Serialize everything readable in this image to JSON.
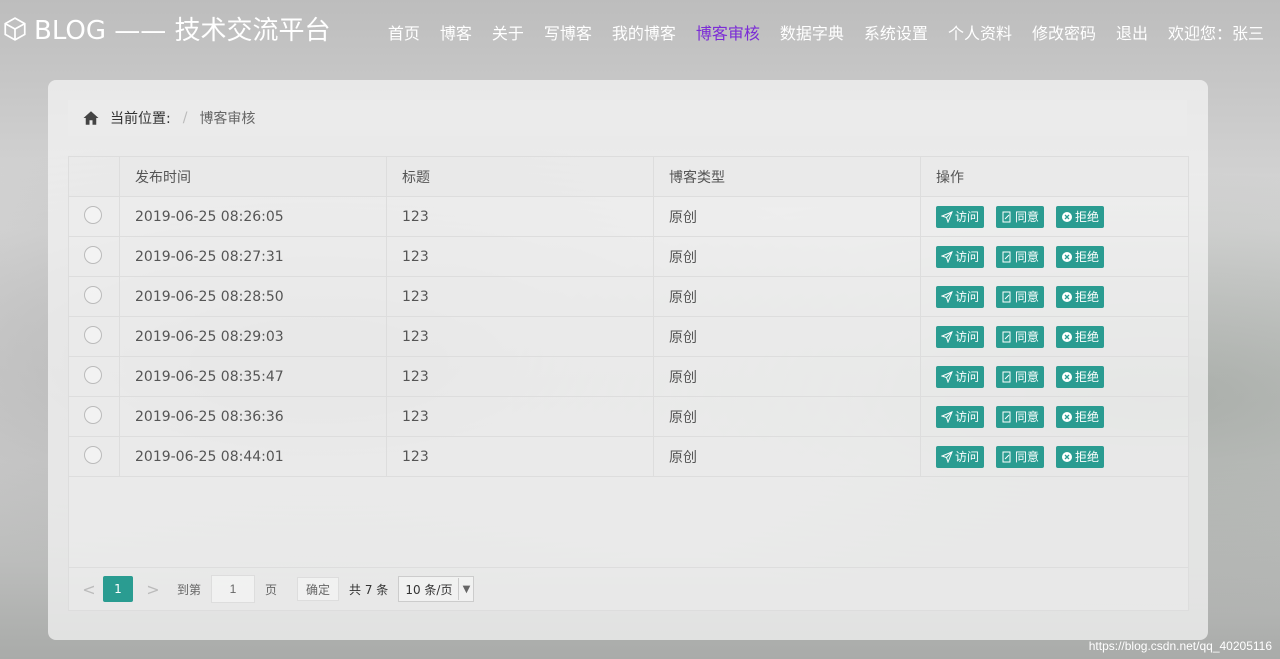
{
  "header": {
    "logo_text": "BLOG —— 技术交流平台",
    "nav": [
      "首页",
      "博客",
      "关于",
      "写博客",
      "我的博客",
      "博客审核",
      "数据字典",
      "系统设置",
      "个人资料",
      "修改密码",
      "退出"
    ],
    "active_nav": "博客审核",
    "welcome": "欢迎您：张三",
    "active_color": "#7b2cd6"
  },
  "breadcrumb": {
    "label": "当前位置:",
    "separator": "/",
    "current": "博客审核"
  },
  "table": {
    "columns": [
      "",
      "发布时间",
      "标题",
      "博客类型",
      "操作"
    ],
    "rows": [
      {
        "time": "2019-06-25 08:26:05",
        "title": "123",
        "type": "原创"
      },
      {
        "time": "2019-06-25 08:27:31",
        "title": "123",
        "type": "原创"
      },
      {
        "time": "2019-06-25 08:28:50",
        "title": "123",
        "type": "原创"
      },
      {
        "time": "2019-06-25 08:29:03",
        "title": "123",
        "type": "原创"
      },
      {
        "time": "2019-06-25 08:35:47",
        "title": "123",
        "type": "原创"
      },
      {
        "time": "2019-06-25 08:36:36",
        "title": "123",
        "type": "原创"
      },
      {
        "time": "2019-06-25 08:44:01",
        "title": "123",
        "type": "原创"
      }
    ],
    "actions": {
      "visit": "访问",
      "approve": "同意",
      "reject": "拒绝"
    },
    "action_color": "#2a9c91"
  },
  "pager": {
    "prev": "<",
    "current_page": "1",
    "next": ">",
    "goto_label": "到第",
    "goto_value": "1",
    "page_label": "页",
    "confirm": "确定",
    "total": "共 7 条",
    "page_size": "10 条/页"
  },
  "watermark": "https://blog.csdn.net/qq_40205116"
}
